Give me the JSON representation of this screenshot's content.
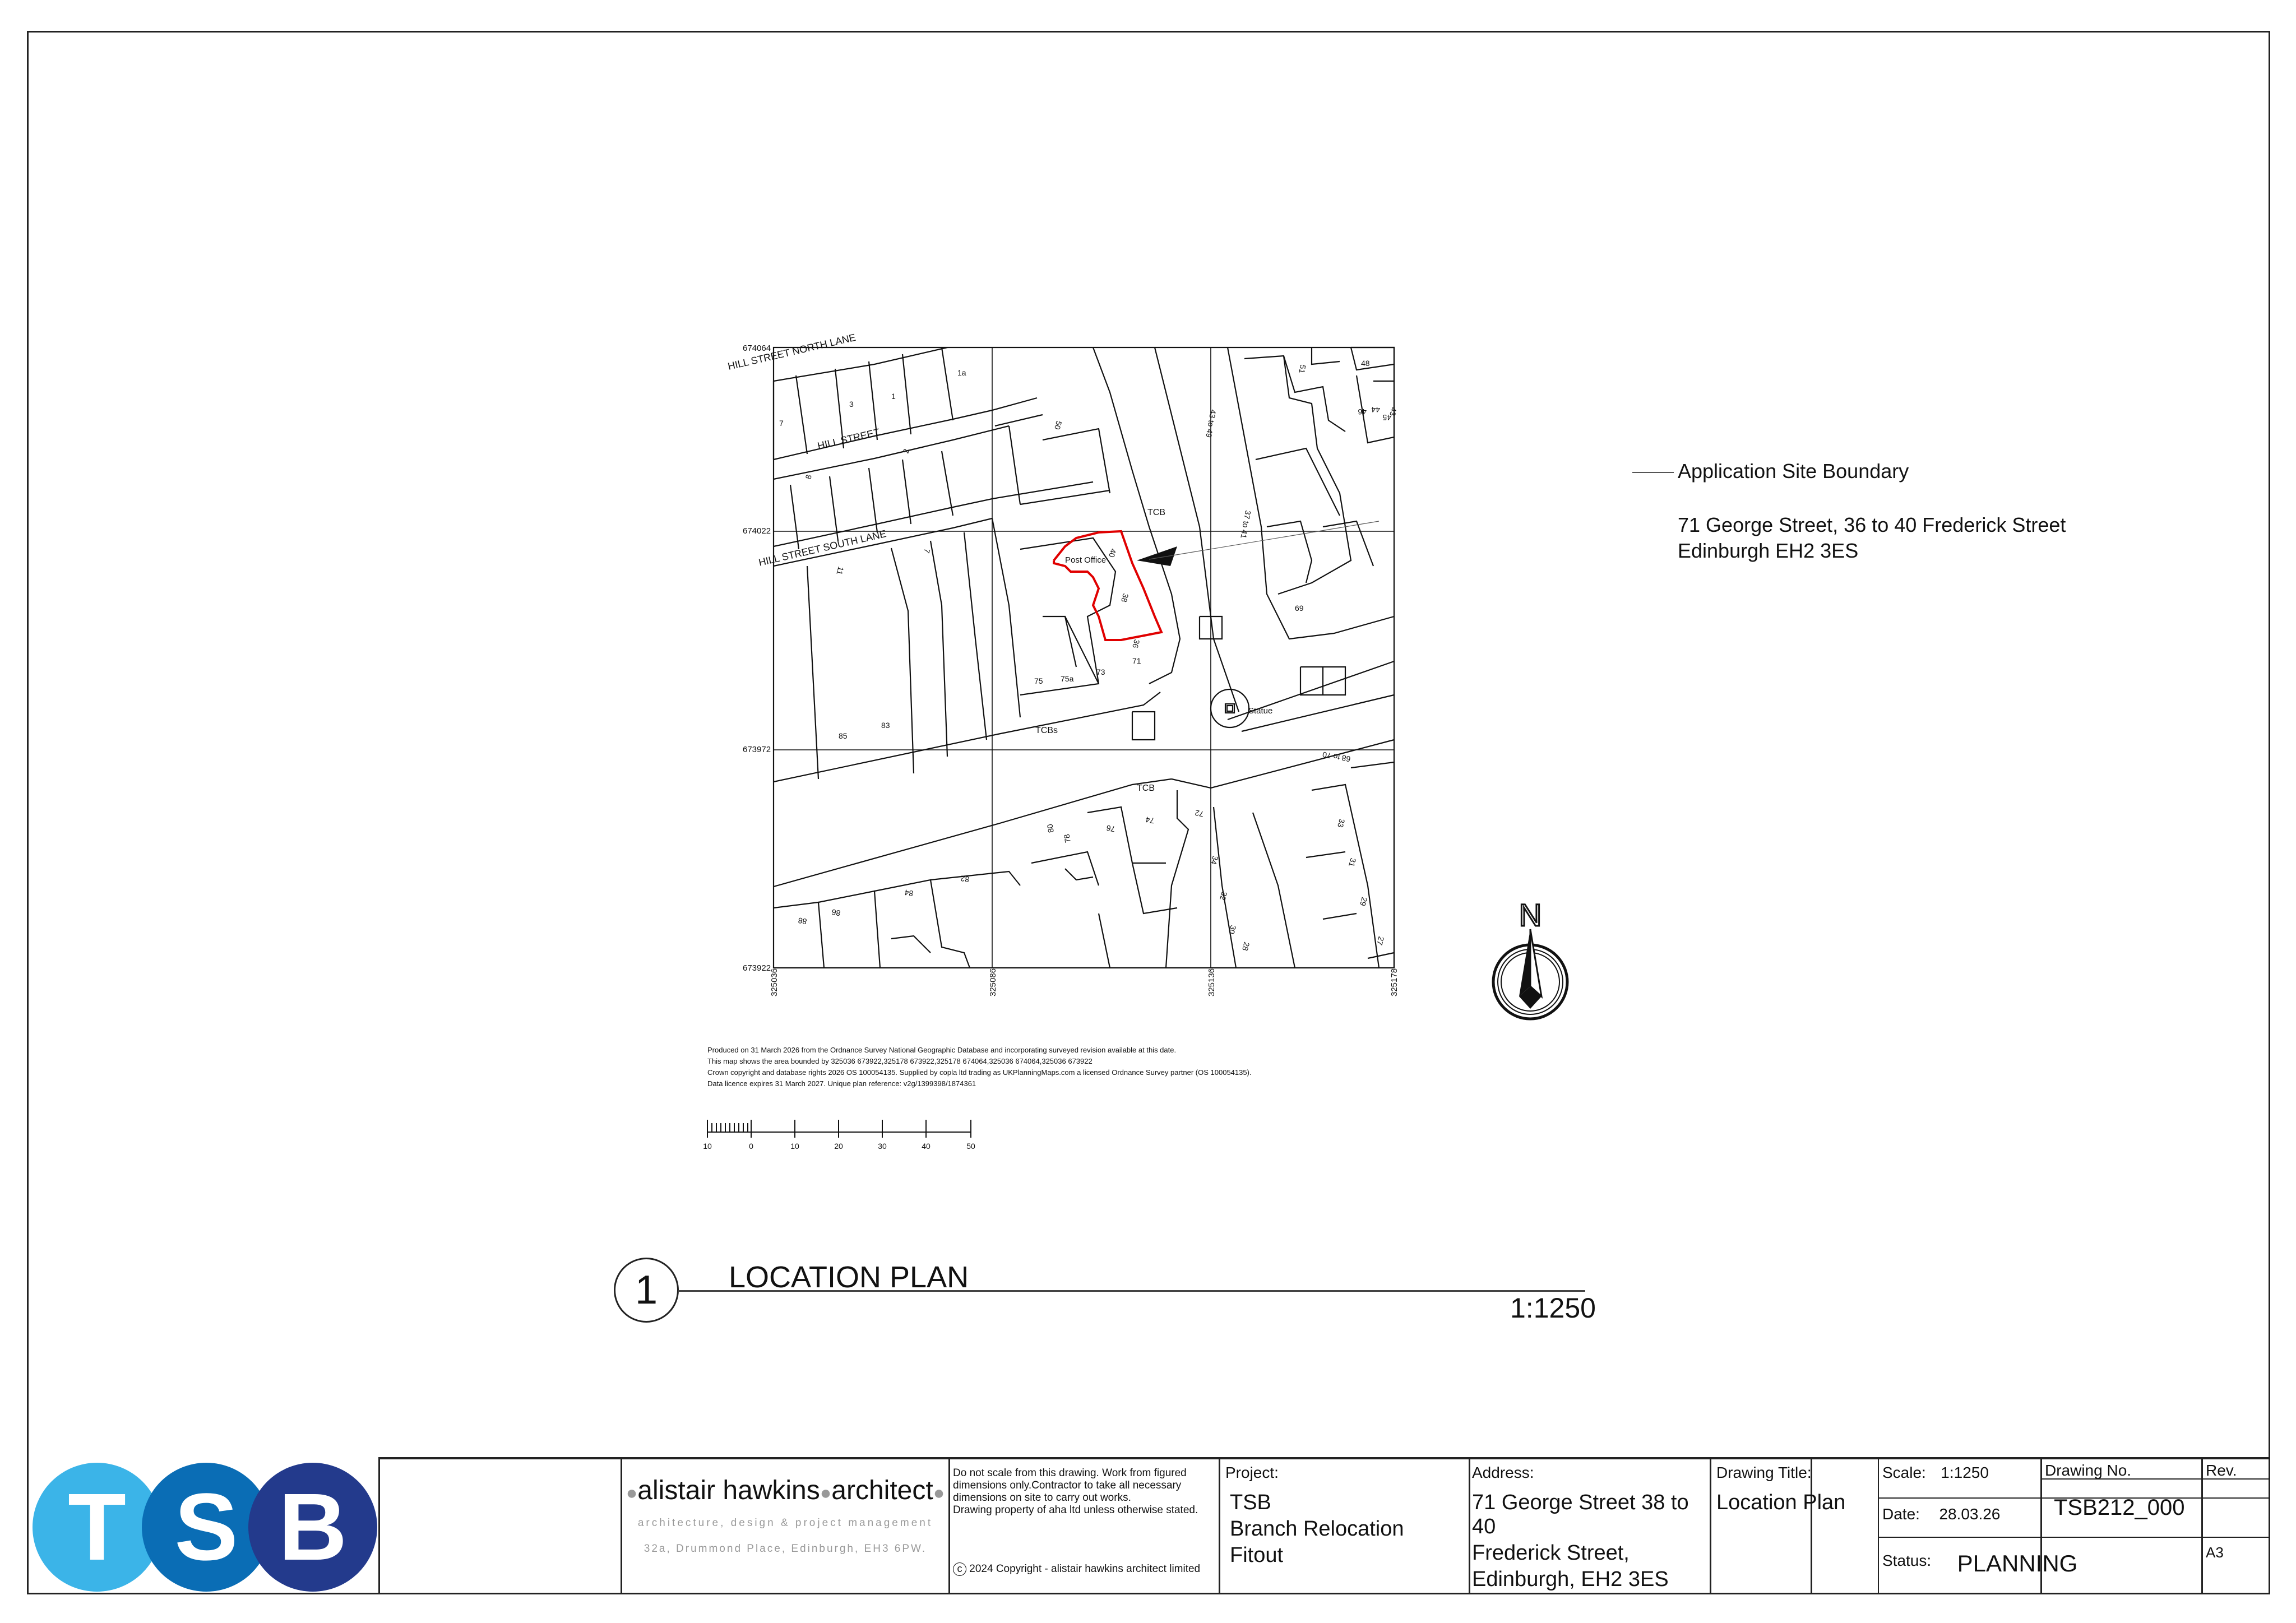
{
  "map": {
    "grid_coords": {
      "northing": [
        "674064",
        "674022",
        "673972",
        "673922"
      ],
      "easting": [
        "325036",
        "325086",
        "325136",
        "325178"
      ]
    },
    "street_labels": [
      "HILL STREET NORTH LANE",
      "HILL STREET",
      "HILL STREET SOUTH LANE",
      "TCB",
      "TCBs",
      "TCB",
      "Post Office",
      "Statue"
    ],
    "building_numbers": [
      "1a",
      "3",
      "1",
      "7",
      "8",
      "2",
      "50",
      "48",
      "46",
      "44",
      "45",
      "43",
      "51",
      "43 to 49",
      "37 to 41",
      "69",
      "7",
      "11",
      "85",
      "83",
      "75",
      "75a",
      "73",
      "71",
      "36",
      "38",
      "40",
      "68 to 70",
      "33",
      "31",
      "29",
      "27",
      "72",
      "74",
      "76",
      "78",
      "80",
      "34",
      "32",
      "30",
      "28",
      "82",
      "84",
      "86",
      "88"
    ],
    "north_label": "N"
  },
  "annotation": {
    "title": "Application Site Boundary",
    "address_line1": "71 George Street, 36 to 40 Frederick Street",
    "address_line2": "Edinburgh EH2 3ES"
  },
  "os_notes": [
    "Produced on 31 March 2026 from the Ordnance Survey National Geographic Database and incorporating surveyed revision available at this date.",
    "This map shows the area bounded by 325036 673922,325178 673922,325178 674064,325036 674064,325036 673922",
    "Crown copyright and database rights 2026 OS 100054135. Supplied by copla ltd trading as UKPlanningMaps.com a licensed Ordnance Survey partner (OS 100054135).",
    "Data licence expires 31 March 2027. Unique plan reference: v2g/1399398/1874361"
  ],
  "scale_bar": {
    "labels": [
      "10",
      "0",
      "10",
      "20",
      "30",
      "40",
      "50"
    ]
  },
  "drawing_label": {
    "number": "1",
    "title": "LOCATION PLAN",
    "scale": "1:1250"
  },
  "title_block": {
    "logo_letters": [
      "T",
      "S",
      "B"
    ],
    "architect_name_a": "alistair hawkins",
    "architect_name_b": "architect",
    "architect_tagline": "architecture, design & project management",
    "architect_address": "32a, Drummond Place, Edinburgh, EH3 6PW.",
    "disclaimer": [
      "Do not scale from this drawing. Work from figured",
      "dimensions only.Contractor to take all necessary",
      "dimensions on site to carry out works.",
      "Drawing property of aha ltd unless otherwise stated."
    ],
    "copyright_symbol": "c",
    "copyright": "2024 Copyright - alistair hawkins architect limited",
    "project_label": "Project:",
    "project_lines": [
      "TSB",
      "Branch Relocation",
      "Fitout"
    ],
    "address_label": "Address:",
    "address_lines": [
      "71 George Street 38 to 40",
      "Frederick Street,",
      "Edinburgh, EH2 3ES"
    ],
    "drawing_title_label": "Drawing Title:",
    "drawing_title": "Location Plan",
    "scale_label": "Scale:",
    "scale_value": "1:1250",
    "date_label": "Date:",
    "date_value": "28.03.26",
    "status_label": "Status:",
    "status_value": "PLANNING",
    "drawing_no_label": "Drawing No.",
    "drawing_no": "TSB212_000",
    "rev_label": "Rev.",
    "sheet_size": "A3"
  },
  "colors": {
    "tsb_light": "#3BB4E8",
    "tsb_mid": "#0A6DB5",
    "tsb_dark": "#233A8C",
    "boundary_red": "#E00000"
  }
}
